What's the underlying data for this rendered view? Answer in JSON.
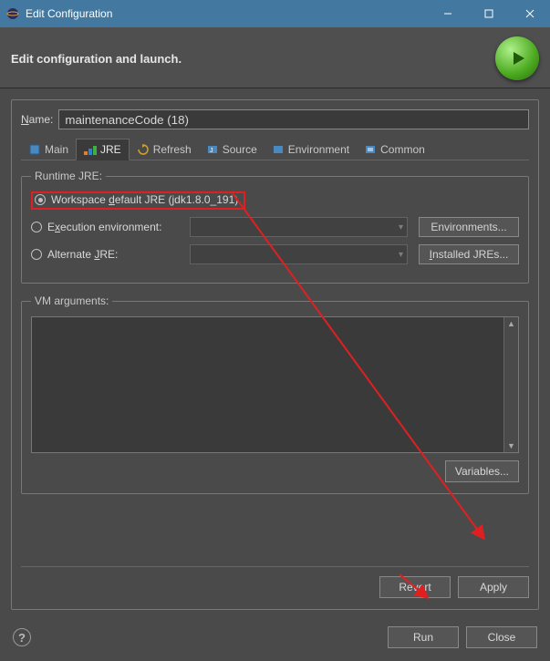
{
  "window": {
    "title": "Edit Configuration"
  },
  "header": {
    "subtitle": "Edit configuration and launch."
  },
  "name": {
    "label": "Name:",
    "mnemonic": "N",
    "value": "maintenanceCode (18)"
  },
  "tabs": {
    "main": "Main",
    "jre": "JRE",
    "refresh": "Refresh",
    "source": "Source",
    "environment": "Environment",
    "common": "Common"
  },
  "runtime": {
    "legend": "Runtime JRE:",
    "workspace_default": "Workspace default JRE (jdk1.8.0_191)",
    "workspace_default_mnemonic": "d",
    "execution_env": "Execution environment:",
    "execution_env_mnemonic": "x",
    "environments_btn": "Environments...",
    "alternate": "Alternate JRE:",
    "alternate_mnemonic": "J",
    "installed_btn": "Installed JREs...",
    "installed_mnemonic": "I"
  },
  "vm": {
    "legend": "VM arguments:",
    "variables_btn": "Variables..."
  },
  "buttons": {
    "revert": "Revert",
    "apply": "Apply",
    "run": "Run",
    "close": "Close"
  }
}
